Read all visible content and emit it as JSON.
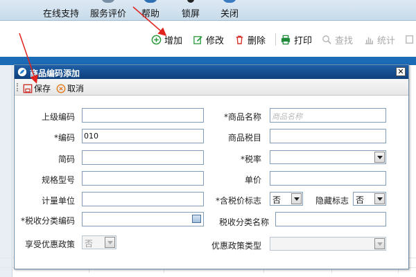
{
  "topnav": {
    "items": [
      {
        "label": "在线支持"
      },
      {
        "label": "服务评价"
      },
      {
        "label": "帮助"
      },
      {
        "label": "锁屏"
      },
      {
        "label": "关闭"
      }
    ]
  },
  "toolbar": {
    "add_label": "增加",
    "edit_label": "修改",
    "delete_label": "删除",
    "print_label": "打印",
    "find_label": "查找",
    "stats_label": "统计"
  },
  "dialog": {
    "title": "商品编码添加",
    "save_label": "保存",
    "cancel_label": "取消",
    "fields": {
      "parent_code_label": "上级编码",
      "parent_code_value": "",
      "name_label": "*商品名称",
      "name_placeholder": "商品名称",
      "code_label": "*编码",
      "code_value": "010",
      "tax_item_label": "商品税目",
      "tax_item_value": "",
      "short_code_label": "简码",
      "short_code_value": "",
      "tax_rate_label": "*税率",
      "tax_rate_value": "",
      "spec_label": "规格型号",
      "spec_value": "",
      "price_label": "单价",
      "price_value": "",
      "unit_label": "计量单位",
      "unit_value": "",
      "tax_included_label": "*含税价标志",
      "tax_included_value": "否",
      "hidden_label": "隐藏标志",
      "hidden_value": "否",
      "tax_class_code_label": "*税收分类编码",
      "tax_class_code_value": "",
      "tax_class_name_label": "税收分类名称",
      "tax_class_name_value": "",
      "preferential_label": "享受优惠政策",
      "preferential_value": "否",
      "preferential_type_label": "优惠政策类型",
      "preferential_type_value": ""
    }
  },
  "colors": {
    "title_bar": "#0e3f7b",
    "grid_header": "#1b6bb6",
    "annotation": "#e0231c"
  }
}
